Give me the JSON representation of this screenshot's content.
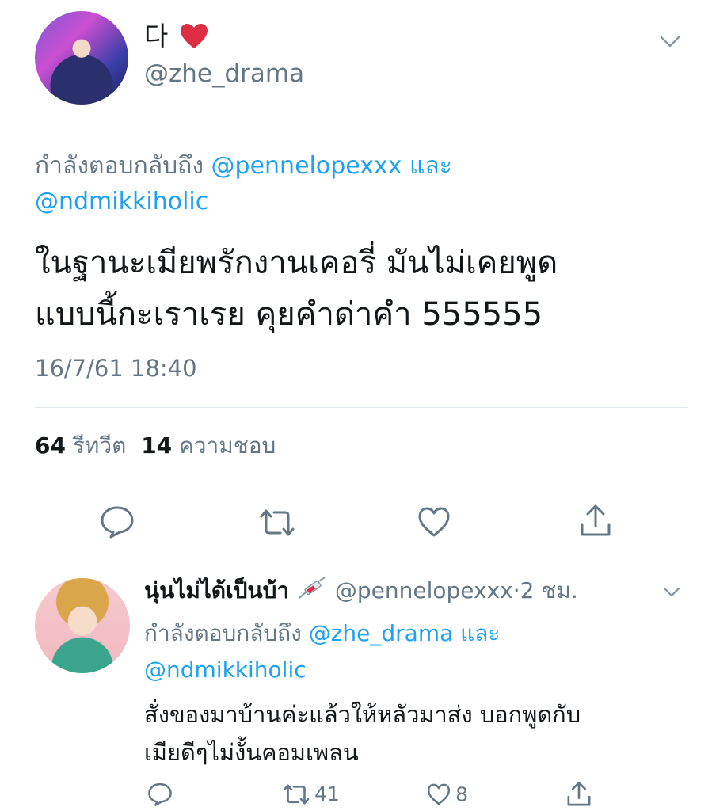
{
  "main_tweet": {
    "author": {
      "display_name": "다",
      "emoji": "❤️",
      "handle": "@zhe_drama"
    },
    "reply_prefix": "กำลังตอบกลับถึง",
    "reply_to_1": "@pennelopexxx",
    "reply_conj": "และ",
    "reply_to_2": "@ndmikkiholic",
    "text_line1": "ในฐานะเมียพรักงานเคอรี่ มันไม่เคยพูด",
    "text_line2": "แบบนี้กะเราเรย คุยคำด่าคำ 555555",
    "timestamp": "16/7/61 18:40",
    "stats": {
      "retweets": "64",
      "retweets_label": "รีทวีต",
      "likes": "14",
      "likes_label": "ความชอบ"
    }
  },
  "reply_tweet": {
    "author": {
      "display_name": "นุ่นไม่ได้เป็นบ้า",
      "handle": "@pennelopexxx",
      "separator": "·",
      "time": "2 ชม."
    },
    "reply_prefix": "กำลังตอบกลับถึง",
    "reply_to_1": "@zhe_drama",
    "reply_conj": "และ",
    "reply_to_2": "@ndmikkiholic",
    "text_line1": "สั่งของมาบ้านค่ะแล้วให้หลัวมาส่ง บอกพูดกับ",
    "text_line2": "เมียดีๆไม่งั้นคอมเพลน",
    "retweet_count": "41",
    "like_count": "8"
  },
  "colors": {
    "link": "#1da1f2",
    "muted": "#657786",
    "divider": "#e1e8ed",
    "heart": "#e0245e"
  },
  "icons": [
    "chevron-down-icon",
    "reply-icon",
    "retweet-icon",
    "like-icon",
    "share-icon",
    "syringe-icon"
  ]
}
